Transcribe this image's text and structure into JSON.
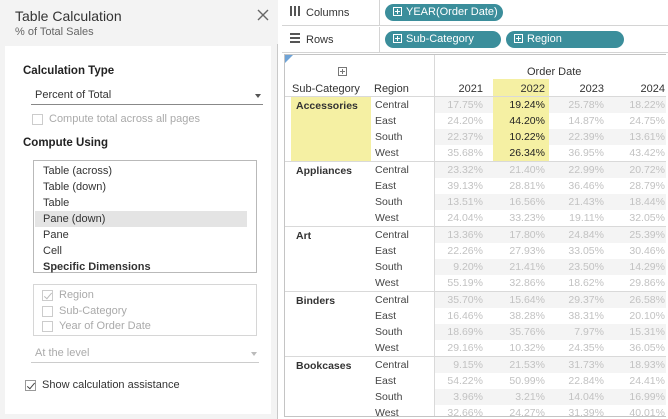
{
  "dialog": {
    "title": "Table Calculation",
    "subtitle": "% of Total Sales",
    "calc_type_label": "Calculation Type",
    "calc_type_value": "Percent of Total",
    "compute_total_label": "Compute total across all pages",
    "compute_using_label": "Compute Using",
    "compute_using_options": [
      "Table (across)",
      "Table (down)",
      "Table",
      "Pane (down)",
      "Pane",
      "Cell",
      "Specific Dimensions"
    ],
    "compute_using_selected": "Pane (down)",
    "dimensions": [
      {
        "label": "Region",
        "checked": true
      },
      {
        "label": "Sub-Category",
        "checked": false
      },
      {
        "label": "Year of Order Date",
        "checked": false
      }
    ],
    "at_level_label": "At the level",
    "show_assist_label": "Show calculation assistance",
    "show_assist_checked": true
  },
  "shelves": {
    "columns_label": "Columns",
    "rows_label": "Rows",
    "columns_pills": [
      "YEAR(Order Date)"
    ],
    "rows_pills": [
      "Sub-Category",
      "Region"
    ]
  },
  "table": {
    "header_group": "Order Date",
    "subcat_header": "Sub-Category",
    "region_header": "Region",
    "years": [
      "2021",
      "2022",
      "2023",
      "2024"
    ],
    "highlight_color": "#f5f0a3",
    "groups": [
      {
        "name": "Accessories",
        "active": true,
        "rows": [
          {
            "region": "Central",
            "values": [
              "17.75%",
              "19.24%",
              "25.78%",
              "18.22%"
            ]
          },
          {
            "region": "East",
            "values": [
              "24.20%",
              "44.20%",
              "14.87%",
              "24.75%"
            ]
          },
          {
            "region": "South",
            "values": [
              "22.37%",
              "10.22%",
              "22.39%",
              "13.61%"
            ]
          },
          {
            "region": "West",
            "values": [
              "35.68%",
              "26.34%",
              "36.95%",
              "43.42%"
            ]
          }
        ]
      },
      {
        "name": "Appliances",
        "active": false,
        "rows": [
          {
            "region": "Central",
            "values": [
              "23.32%",
              "21.40%",
              "22.99%",
              "20.72%"
            ]
          },
          {
            "region": "East",
            "values": [
              "39.13%",
              "28.81%",
              "36.46%",
              "28.79%"
            ]
          },
          {
            "region": "South",
            "values": [
              "13.51%",
              "16.56%",
              "21.43%",
              "18.44%"
            ]
          },
          {
            "region": "West",
            "values": [
              "24.04%",
              "33.23%",
              "19.11%",
              "32.05%"
            ]
          }
        ]
      },
      {
        "name": "Art",
        "active": false,
        "rows": [
          {
            "region": "Central",
            "values": [
              "13.36%",
              "17.80%",
              "24.84%",
              "25.39%"
            ]
          },
          {
            "region": "East",
            "values": [
              "22.26%",
              "27.93%",
              "33.05%",
              "30.46%"
            ]
          },
          {
            "region": "South",
            "values": [
              "9.20%",
              "21.41%",
              "23.50%",
              "14.29%"
            ]
          },
          {
            "region": "West",
            "values": [
              "55.19%",
              "32.86%",
              "18.62%",
              "29.86%"
            ]
          }
        ]
      },
      {
        "name": "Binders",
        "active": false,
        "rows": [
          {
            "region": "Central",
            "values": [
              "35.70%",
              "15.64%",
              "29.37%",
              "26.58%"
            ]
          },
          {
            "region": "East",
            "values": [
              "16.46%",
              "38.28%",
              "38.31%",
              "20.10%"
            ]
          },
          {
            "region": "South",
            "values": [
              "18.69%",
              "35.76%",
              "7.97%",
              "15.31%"
            ]
          },
          {
            "region": "West",
            "values": [
              "29.16%",
              "10.32%",
              "24.35%",
              "36.05%"
            ]
          }
        ]
      },
      {
        "name": "Bookcases",
        "active": false,
        "rows": [
          {
            "region": "Central",
            "values": [
              "9.15%",
              "21.53%",
              "31.73%",
              "18.93%"
            ]
          },
          {
            "region": "East",
            "values": [
              "54.22%",
              "50.99%",
              "22.84%",
              "24.41%"
            ]
          },
          {
            "region": "South",
            "values": [
              "3.96%",
              "3.21%",
              "14.04%",
              "16.99%"
            ]
          },
          {
            "region": "West",
            "values": [
              "32.66%",
              "24.27%",
              "31.39%",
              "40.01%"
            ]
          }
        ]
      }
    ]
  }
}
